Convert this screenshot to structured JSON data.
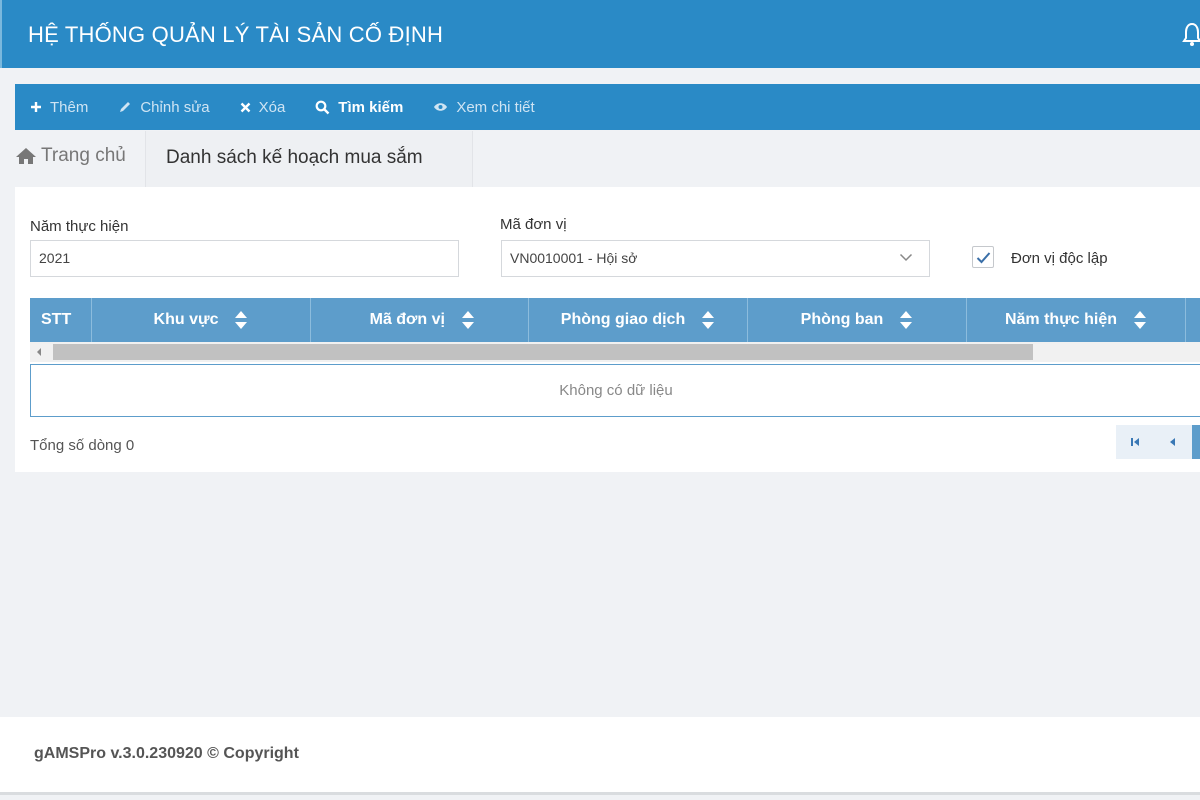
{
  "app": {
    "title": "HỆ THỐNG QUẢN LÝ TÀI SẢN CỐ ĐỊNH"
  },
  "toolbar": {
    "buttons": [
      {
        "label": "Thêm",
        "icon": "plus-icon"
      },
      {
        "label": "Chỉnh sửa",
        "icon": "pencil-icon"
      },
      {
        "label": "Xóa",
        "icon": "times-icon"
      },
      {
        "label": "Tìm kiếm",
        "icon": "search-icon",
        "active": true
      },
      {
        "label": "Xem chi tiết",
        "icon": "eye-icon"
      }
    ]
  },
  "breadcrumb": {
    "home": "Trang chủ",
    "current": "Danh sách kế hoạch mua sắm"
  },
  "filters": {
    "year_label": "Năm thực hiện",
    "year_value": "2021",
    "unit_label": "Mã đơn vị",
    "unit_value": "VN0010001 - Hội sở",
    "independent_label": "Đơn vị độc lập",
    "independent_checked": true
  },
  "table": {
    "columns": [
      "STT",
      "Khu vực",
      "Mã đơn vị",
      "Phòng giao dịch",
      "Phòng ban",
      "Năm thực hiện"
    ],
    "empty_text": "Không có dữ liệu",
    "total_text": "Tổng số dòng 0"
  },
  "footer": {
    "copyright": "gAMSPro v.3.0.230920 © Copyright"
  },
  "colors": {
    "primary": "#2a8ac6",
    "table_header": "#5d9dcb",
    "background": "#f0f2f5"
  }
}
